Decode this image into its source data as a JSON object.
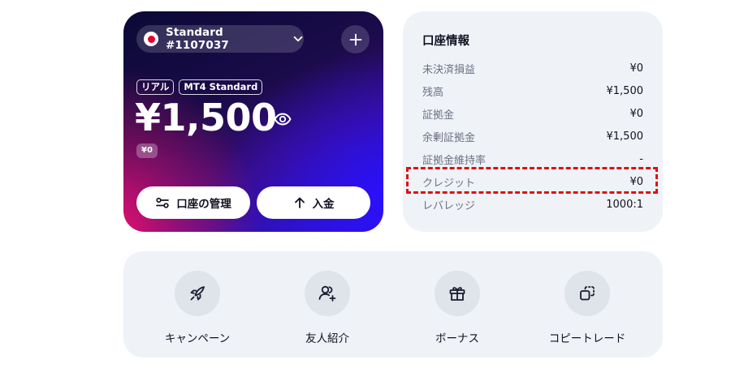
{
  "account_card": {
    "account_name": "Standard #1107037",
    "tags": [
      "リアル",
      "MT4 Standard"
    ],
    "balance": "¥1,500",
    "sub_value": "¥0",
    "manage_label": "口座の管理",
    "deposit_label": "入金",
    "gradient_colors": [
      "#0b0a36",
      "#3a0d7a",
      "#2b10ff",
      "#e0106e"
    ]
  },
  "info_panel": {
    "title": "口座情報",
    "rows": [
      {
        "label": "未決済損益",
        "value": "¥0"
      },
      {
        "label": "残高",
        "value": "¥1,500"
      },
      {
        "label": "証拠金",
        "value": "¥0"
      },
      {
        "label": "余剰証拠金",
        "value": "¥1,500"
      },
      {
        "label": "証拠金維持率",
        "value": "-"
      },
      {
        "label": "クレジット",
        "value": "¥0"
      },
      {
        "label": "レバレッジ",
        "value": "1000:1"
      }
    ],
    "highlighted_row": "クレジット",
    "highlight_color": "#dd1111"
  },
  "actions": [
    {
      "label": "キャンペーン",
      "icon": "rocket-icon"
    },
    {
      "label": "友人紹介",
      "icon": "user-plus-icon"
    },
    {
      "label": "ボーナス",
      "icon": "gift-icon"
    },
    {
      "label": "コピートレード",
      "icon": "copy-trade-icon"
    }
  ]
}
